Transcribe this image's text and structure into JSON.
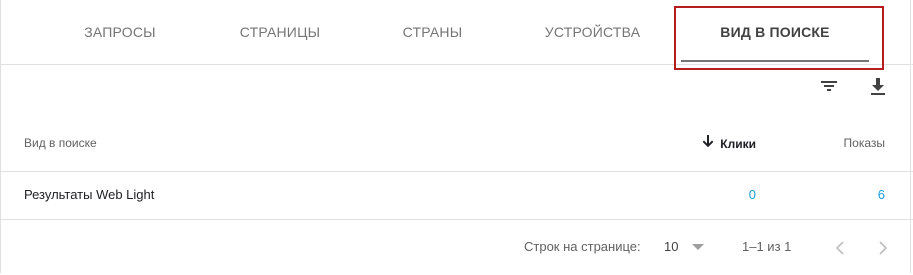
{
  "tabs": [
    {
      "label": "ЗАПРОСЫ"
    },
    {
      "label": "СТРАНИЦЫ"
    },
    {
      "label": "СТРАНЫ"
    },
    {
      "label": "УСТРОЙСТВА"
    },
    {
      "label": "ВИД В ПОИСКЕ"
    }
  ],
  "active_tab": "ВИД В ПОИСКЕ",
  "toolbar": {
    "filter_icon": "filter-icon",
    "download_icon": "download-icon"
  },
  "table": {
    "columns": {
      "name": "Вид в поиске",
      "clicks": "Клики",
      "impressions": "Показы"
    },
    "sort_icon": "arrow-down-icon",
    "rows": [
      {
        "name": "Результаты Web Light",
        "clicks": "0",
        "impressions": "6"
      }
    ]
  },
  "pagination": {
    "rows_per_page_label": "Строк на странице:",
    "rows_per_page": "10",
    "range": "1–1 из 1"
  },
  "colors": {
    "accent_link": "#1a9fd9",
    "highlight_border": "#b71c1c"
  }
}
